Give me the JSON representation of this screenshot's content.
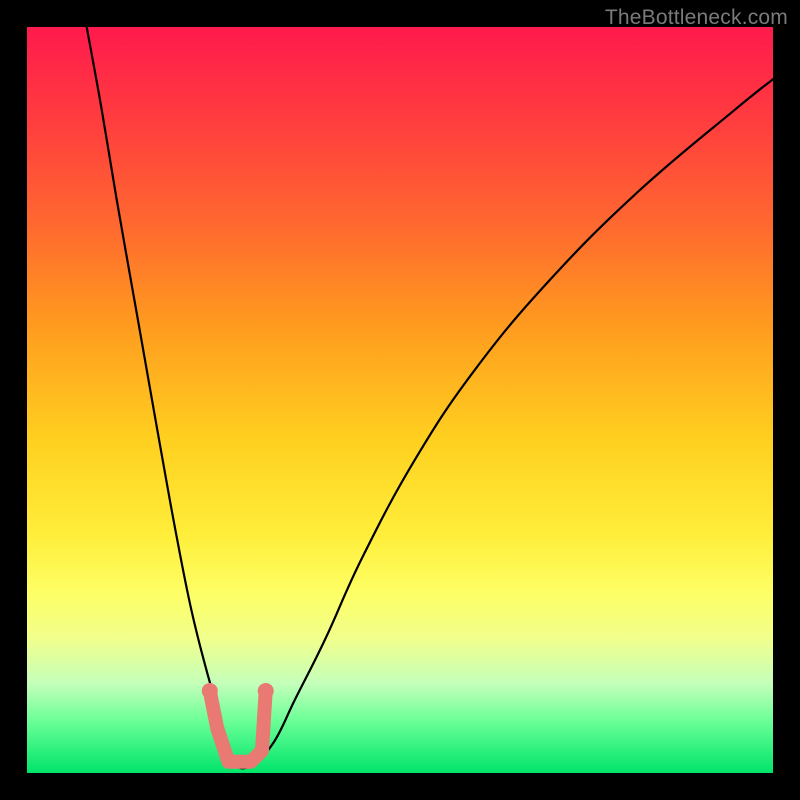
{
  "watermark": {
    "text": "TheBottleneck.com"
  },
  "chart_data": {
    "type": "line",
    "title": "",
    "xlabel": "",
    "ylabel": "",
    "xlim": [
      0,
      100
    ],
    "ylim": [
      0,
      100
    ],
    "grid": false,
    "legend": false,
    "background_gradient": {
      "direction": "vertical",
      "stops": [
        {
          "pos": 0.0,
          "color": "#ff1a4d"
        },
        {
          "pos": 0.4,
          "color": "#ff9b1f"
        },
        {
          "pos": 0.7,
          "color": "#ffee3a"
        },
        {
          "pos": 1.0,
          "color": "#00e46a"
        }
      ]
    },
    "series": [
      {
        "name": "bottleneck-curve",
        "color": "#000000",
        "x": [
          8,
          10,
          12,
          15,
          18,
          20,
          22,
          24,
          26,
          27,
          28,
          30,
          33,
          36,
          40,
          45,
          52,
          60,
          70,
          82,
          95,
          100
        ],
        "values": [
          100,
          89,
          77,
          60,
          43,
          32,
          22,
          14,
          7,
          3,
          1,
          1,
          4,
          10,
          18,
          29,
          42,
          54,
          66,
          78,
          89,
          93
        ]
      }
    ],
    "highlight_band": {
      "name": "green-zone-markers",
      "color": "#e97a73",
      "points": [
        {
          "x": 24.5,
          "value": 11
        },
        {
          "x": 25.5,
          "value": 6
        },
        {
          "x": 27.0,
          "value": 1.5
        },
        {
          "x": 30.0,
          "value": 1.5
        },
        {
          "x": 31.5,
          "value": 3
        },
        {
          "x": 32.0,
          "value": 11
        }
      ]
    }
  }
}
